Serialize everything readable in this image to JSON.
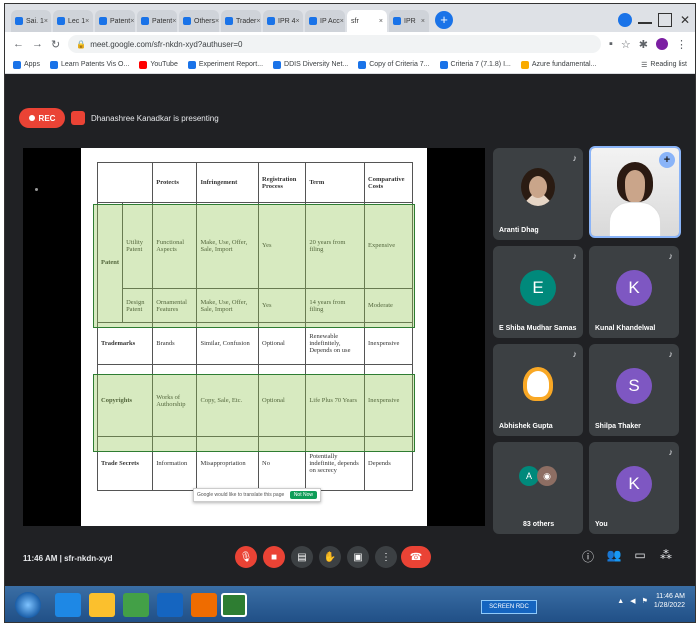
{
  "browser": {
    "tabs": [
      {
        "label": "Sai. 1",
        "favicon": "doc",
        "active": false
      },
      {
        "label": "Lec 1",
        "favicon": "doc",
        "active": false
      },
      {
        "label": "Patent",
        "favicon": "doc",
        "active": false
      },
      {
        "label": "Patent",
        "favicon": "doc",
        "active": false
      },
      {
        "label": "Others",
        "favicon": "doc",
        "active": false
      },
      {
        "label": "Trader",
        "favicon": "doc",
        "active": false
      },
      {
        "label": "IPR 4",
        "favicon": "doc",
        "active": false
      },
      {
        "label": "IP Acc",
        "favicon": "doc",
        "active": false
      },
      {
        "label": "sfr",
        "favicon": "meet",
        "active": true
      },
      {
        "label": "IPR",
        "favicon": "doc",
        "active": false
      }
    ],
    "new_tab": "+",
    "address": "meet.google.com/sfr-nkdn-xyd?authuser=0",
    "bookmarks": [
      {
        "label": "Apps",
        "color": "#1a73e8"
      },
      {
        "label": "Learn Patents Vis O...",
        "color": "#1a73e8"
      },
      {
        "label": "YouTube",
        "color": "#ff0000"
      },
      {
        "label": "Experiment Report...",
        "color": "#1a73e8"
      },
      {
        "label": "DDIS Diversity Net...",
        "color": "#1a73e8"
      },
      {
        "label": "Copy of Criteria 7...",
        "color": "#1a73e8"
      },
      {
        "label": "Criteria 7 (7.1.8) I...",
        "color": "#1a73e8"
      },
      {
        "label": "Azure fundamental...",
        "color": "#f9ab00"
      }
    ],
    "reading_list": "Reading list"
  },
  "meet": {
    "rec_label": "REC",
    "presenting_text": "Dhanashree Kanadkar is presenting",
    "meeting_time": "11:46 AM",
    "meeting_code": "sfr-nkdn-xyd",
    "participants": [
      {
        "name": "Aranti Dhag",
        "kind": "photo-girl"
      },
      {
        "name": "",
        "kind": "self"
      },
      {
        "name": "E Shiba Mudhar Samas",
        "kind": "letter",
        "letter": "E",
        "color": "teal"
      },
      {
        "name": "Kunal Khandelwal",
        "kind": "letter",
        "letter": "K",
        "color": "purple"
      },
      {
        "name": "Abhishek Gupta",
        "kind": "photo-flame"
      },
      {
        "name": "Shilpa Thaker",
        "kind": "letter",
        "letter": "S",
        "color": "purple"
      },
      {
        "name": "83 others",
        "kind": "others"
      },
      {
        "name": "You",
        "kind": "letter",
        "letter": "K",
        "color": "purple"
      }
    ]
  },
  "slide_table": {
    "headers": [
      "",
      "",
      "Protects",
      "Infringement",
      "Registration Process",
      "Term",
      "Comparative Costs"
    ],
    "patent_label": "Patent",
    "rows": [
      {
        "sub": "Utility Patent",
        "protects": "Functional Aspects",
        "infringement": "Make, Use, Offer, Sale, Import",
        "registration": "Yes",
        "term": "20 years from filing",
        "cost": "Expensive"
      },
      {
        "sub": "Design Patent",
        "protects": "Ornamental Features",
        "infringement": "Make, Use, Offer, Sale, Import",
        "registration": "Yes",
        "term": "14 years from filing",
        "cost": "Moderate"
      },
      {
        "main": "Trademarks",
        "protects": "Brands",
        "infringement": "Similar, Confusion",
        "registration": "Optional",
        "term": "Renewable indefinitely, Depends on use",
        "cost": "Inexpensive"
      },
      {
        "main": "Copyrights",
        "protects": "Works of Authorship",
        "infringement": "Copy, Sale, Etc.",
        "registration": "Optional",
        "term": "Life Plus 70 Years",
        "cost": "Inexpensive"
      },
      {
        "main": "Trade Secrets",
        "protects": "Information",
        "infringement": "Misappropriation",
        "registration": "No",
        "term": "Potentially indefinite, depends on secrecy",
        "cost": "Depends"
      }
    ],
    "popup_text": "Google would like to translate this page",
    "popup_button": "Not Now"
  },
  "taskbar": {
    "flag_text": "SCREEN RDC",
    "time": "11:46 AM",
    "date": "1/28/2022"
  },
  "colors": {
    "meet_bg": "#202124",
    "tile_bg": "#3c4043",
    "rec_red": "#ea4335",
    "highlight_green": "#8bc34a",
    "accent_blue": "#8ab4f8"
  }
}
